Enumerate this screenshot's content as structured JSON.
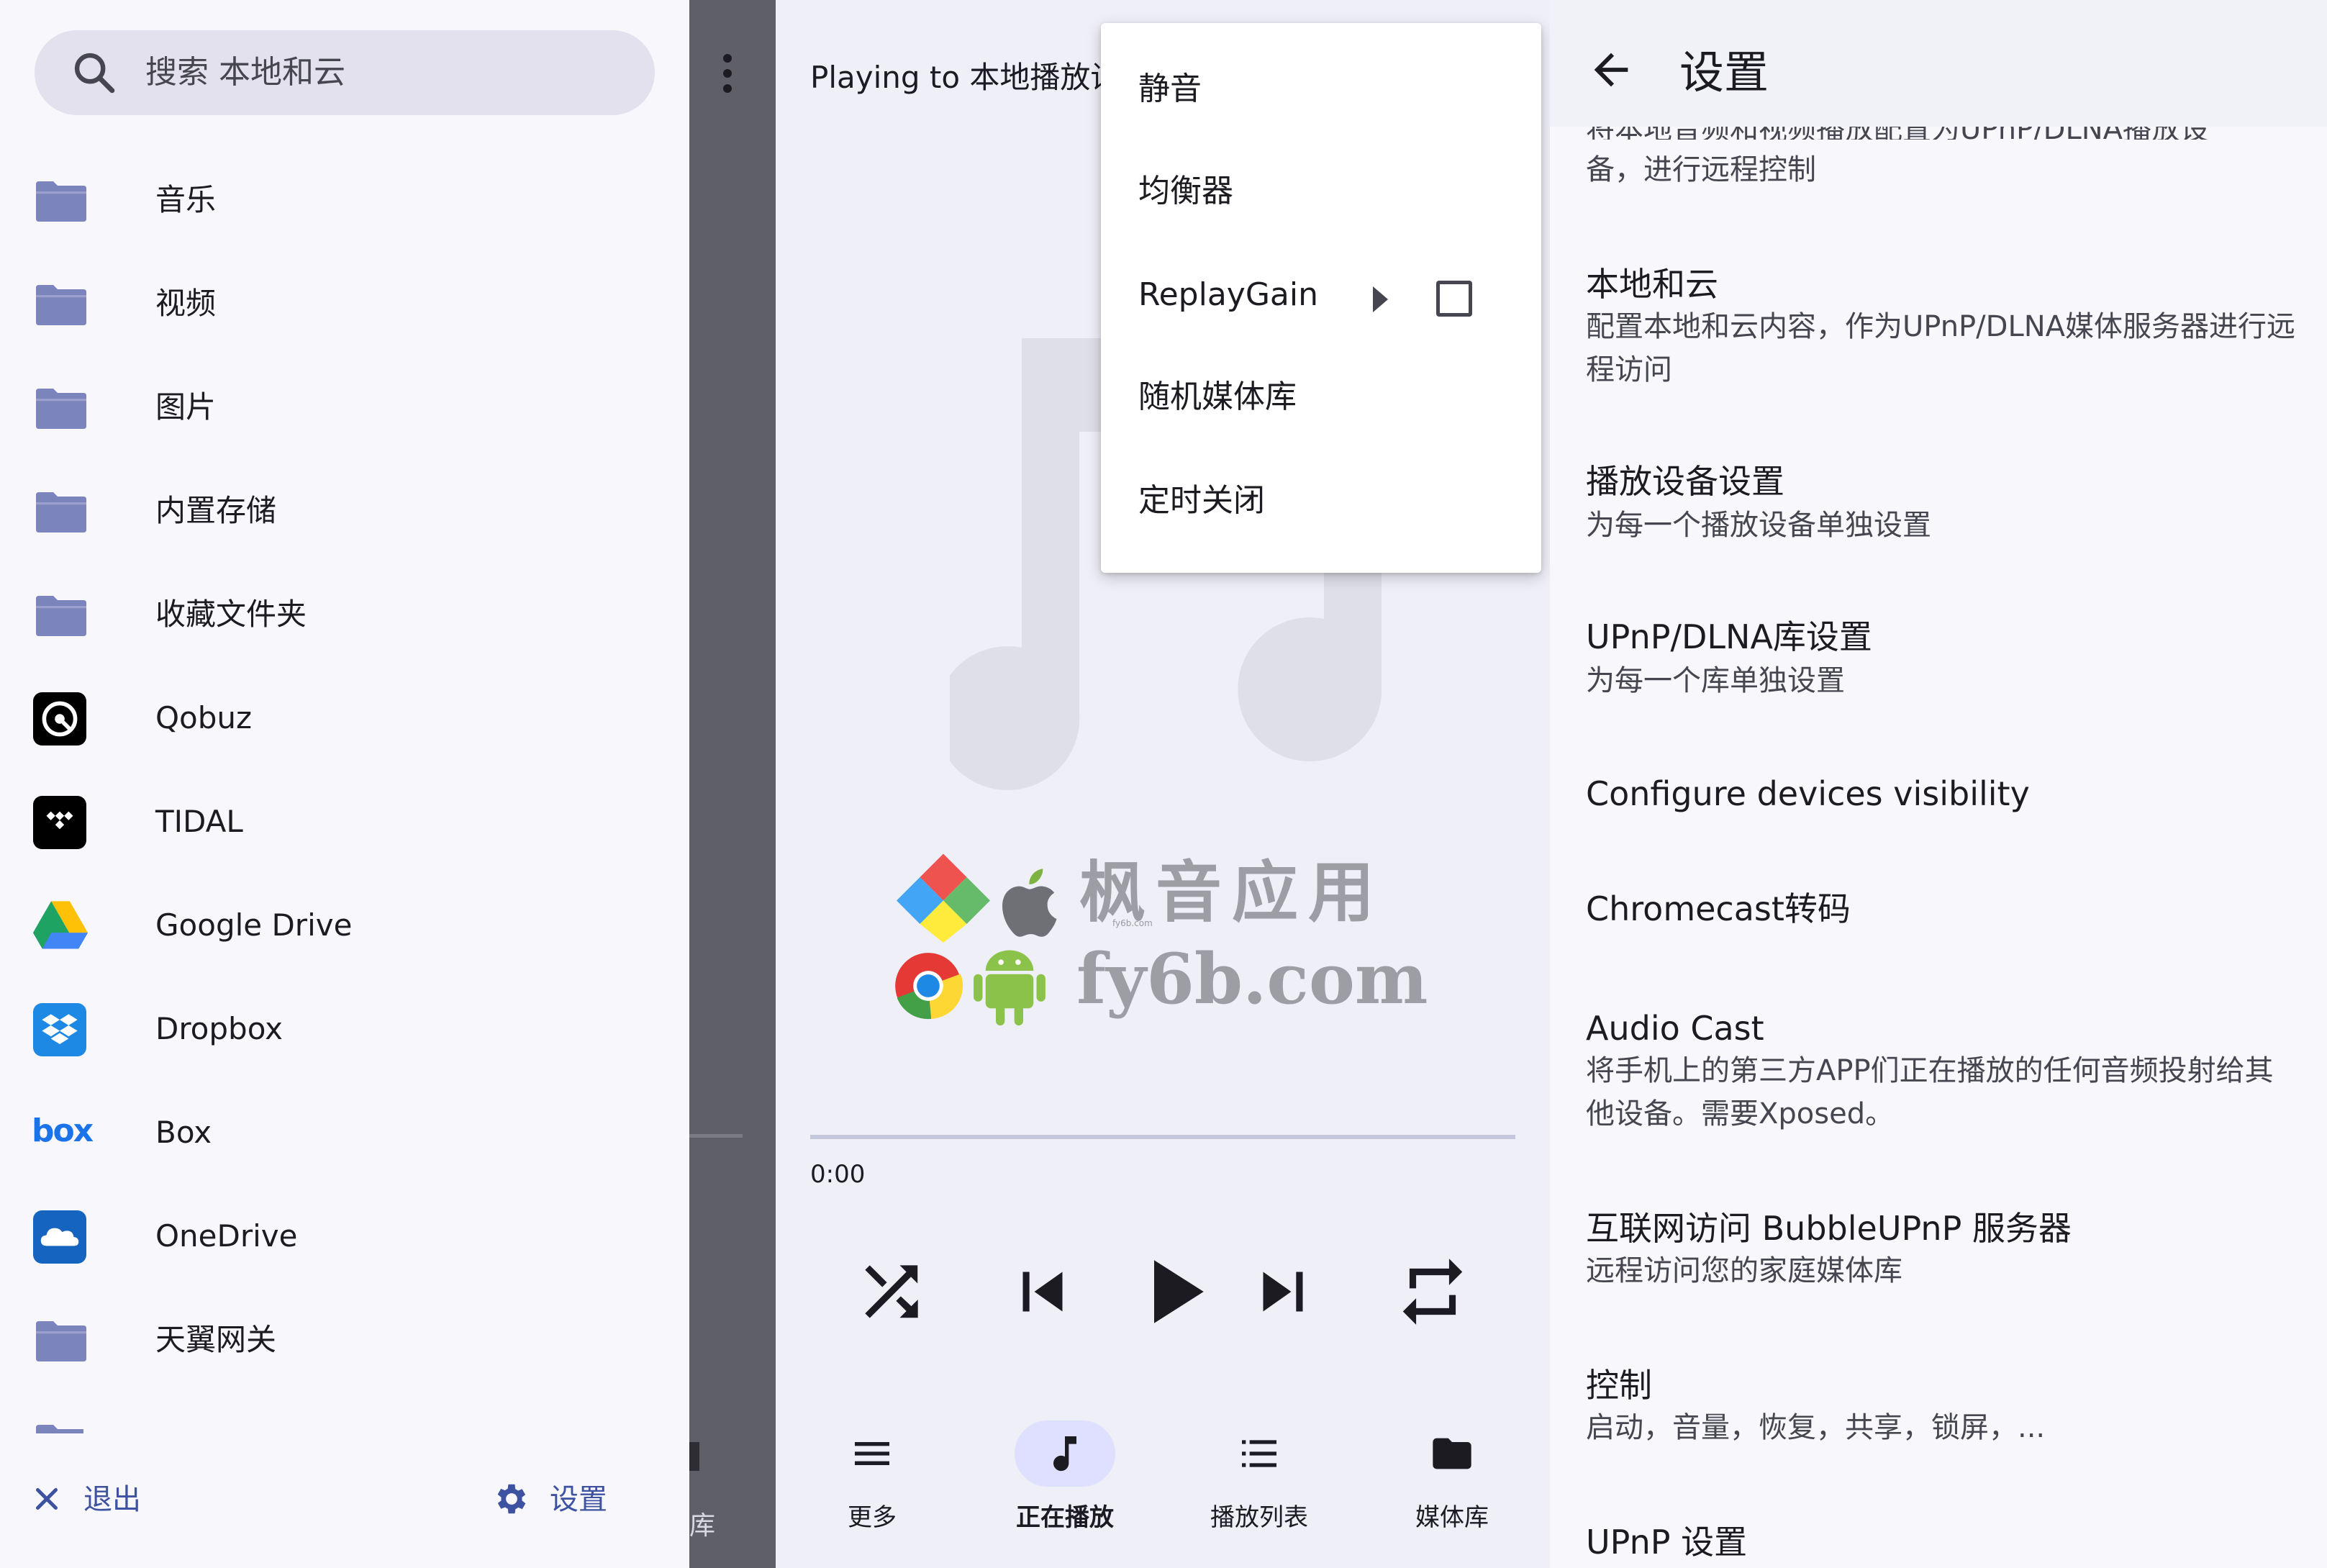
{
  "drawer": {
    "search_placeholder": "搜索 本地和云",
    "items": [
      {
        "label": "音乐",
        "icon": "folder-icon"
      },
      {
        "label": "视频",
        "icon": "folder-icon"
      },
      {
        "label": "图片",
        "icon": "folder-icon"
      },
      {
        "label": "内置存储",
        "icon": "folder-icon"
      },
      {
        "label": "收藏文件夹",
        "icon": "folder-icon"
      },
      {
        "label": "Qobuz",
        "icon": "qobuz-icon"
      },
      {
        "label": "TIDAL",
        "icon": "tidal-icon"
      },
      {
        "label": "Google Drive",
        "icon": "google-drive-icon"
      },
      {
        "label": "Dropbox",
        "icon": "dropbox-icon"
      },
      {
        "label": "Box",
        "icon": "box-icon",
        "logo_text": "box"
      },
      {
        "label": "OneDrive",
        "icon": "onedrive-icon"
      },
      {
        "label": "天翼网关",
        "icon": "folder-icon"
      }
    ],
    "exit_label": "退出",
    "settings_label": "设置",
    "accent_color": "#3d52a0",
    "folder_color": "#7c84bd"
  },
  "background_strip": {
    "nav_label_partial": "库"
  },
  "player": {
    "playing_to": "Playing to 本地播放设",
    "time_elapsed": "0:00",
    "progress": 0,
    "controls": [
      "shuffle-icon",
      "skip-previous-icon",
      "play-icon",
      "skip-next-icon",
      "repeat-icon"
    ],
    "nav": [
      {
        "label": "更多",
        "icon": "menu-lines-icon",
        "active": false
      },
      {
        "label": "正在播放",
        "icon": "music-note-icon",
        "active": true
      },
      {
        "label": "播放列表",
        "icon": "playlist-icon",
        "active": false
      },
      {
        "label": "媒体库",
        "icon": "folder-icon",
        "active": false
      }
    ],
    "watermark": {
      "text_cn": "枫音应用",
      "text_en": "fy6b.com",
      "text_small": "fy6b.com"
    }
  },
  "menu": {
    "items": [
      {
        "label": "静音"
      },
      {
        "label": "均衡器"
      },
      {
        "label": "ReplayGain",
        "has_submenu": true,
        "checkbox": false
      },
      {
        "label": "随机媒体库"
      },
      {
        "label": "定时关闭"
      }
    ]
  },
  "settings": {
    "title": "设置",
    "partial_top": "将本地音频和视频播放配置为UPnP/DLNA播放设",
    "partial_summary": "备，进行远程控制",
    "items": [
      {
        "title": "本地和云",
        "summary": "配置本地和云内容，作为UPnP/DLNA媒体服务器进行远程访问"
      },
      {
        "title": "播放设备设置",
        "summary": "为每一个播放设备单独设置"
      },
      {
        "title": "UPnP/DLNA库设置",
        "summary": "为每一个库单独设置"
      },
      {
        "title": "Configure devices visibility",
        "summary": ""
      },
      {
        "title": "Chromecast转码",
        "summary": ""
      },
      {
        "title": "Audio Cast",
        "summary": "将手机上的第三方APP们正在播放的任何音频投射给其他设备。需要Xposed。"
      },
      {
        "title": "互联网访问 BubbleUPnP 服务器",
        "summary": "远程访问您的家庭媒体库"
      },
      {
        "title": "控制",
        "summary": "启动，音量，恢复，共享，锁屏，..."
      },
      {
        "title": "UPnP 设置",
        "summary": ""
      }
    ]
  }
}
